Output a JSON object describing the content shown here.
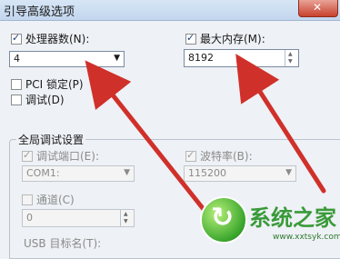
{
  "window": {
    "title": "引导高级选项",
    "close_glyph": "✕"
  },
  "processors": {
    "label": "处理器数(N):",
    "checked": true,
    "value": "4"
  },
  "max_memory": {
    "label": "最大内存(M):",
    "checked": true,
    "value": "8192"
  },
  "pci_lock": {
    "label": "PCI 锁定(P)",
    "checked": false
  },
  "debug": {
    "label": "调试(D)",
    "checked": false
  },
  "global_debug": {
    "group_title": "全局调试设置",
    "debug_port": {
      "label": "调试端口(E):",
      "checked": true,
      "value": "COM1:"
    },
    "baud_rate": {
      "label": "波特率(B):",
      "checked": true,
      "value": "115200"
    },
    "channel": {
      "label": "通道(C)",
      "checked": false,
      "value": "0"
    },
    "usb_target": {
      "label": "USB 目标名(T):"
    }
  },
  "watermark": {
    "text": "系统之家",
    "url": "www.xxtsyk.com"
  },
  "colors": {
    "arrow": "#d0302a",
    "accent": "#1f3e7a"
  },
  "icons": {
    "dropdown": "dropdown-arrow-icon",
    "spin": "spin-arrows-icon",
    "check": "checkmark-icon"
  }
}
